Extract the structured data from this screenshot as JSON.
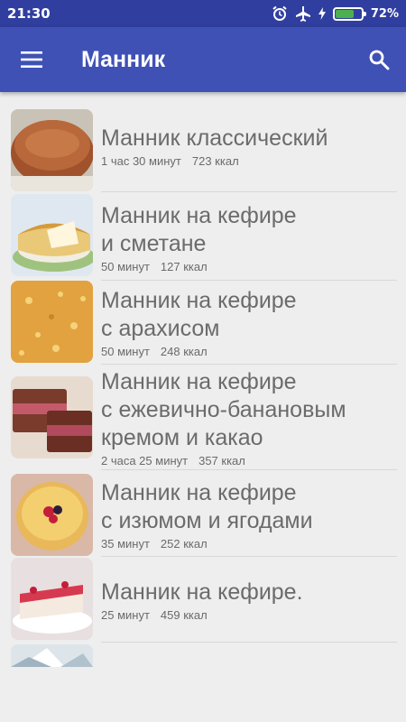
{
  "status_bar": {
    "time": "21:30",
    "battery_percent": "72%",
    "battery_level": 0.72,
    "icons": [
      "alarm-icon",
      "airplane-icon",
      "charging-icon",
      "battery-icon"
    ]
  },
  "app_bar": {
    "title": "Манник",
    "menu_icon": "menu-icon",
    "search_icon": "search-icon",
    "color": "#3f51b5"
  },
  "recipes": [
    {
      "title_lines": [
        "Манник классический"
      ],
      "time": "1 час 30 минут",
      "kcal": "723 ккал"
    },
    {
      "title_lines": [
        "Манник на кефире",
        "и сметане"
      ],
      "time": "50 минут",
      "kcal": "127 ккал"
    },
    {
      "title_lines": [
        "Манник на кефире",
        "с арахисом"
      ],
      "time": "50 минут",
      "kcal": "248 ккал"
    },
    {
      "title_lines": [
        "Манник на кефире",
        "с ежевично-банановым",
        "кремом и какао"
      ],
      "time": "2 часа 25 минут",
      "kcal": "357 ккал"
    },
    {
      "title_lines": [
        "Манник на кефире",
        "с изюмом и ягодами"
      ],
      "time": "35 минут",
      "kcal": "252 ккал"
    },
    {
      "title_lines": [
        "Манник на кефире."
      ],
      "time": "25 минут",
      "kcal": "459 ккал"
    }
  ]
}
